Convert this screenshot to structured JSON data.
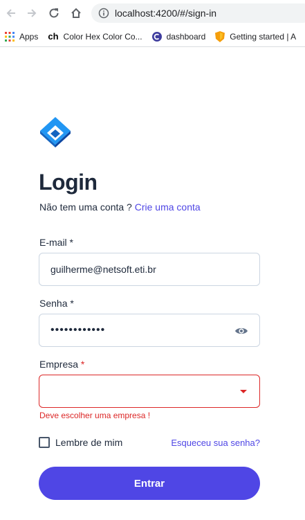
{
  "browser": {
    "url": "localhost:4200/#/sign-in",
    "bookmarks": [
      {
        "label": "Apps",
        "icon": "apps-grid-icon"
      },
      {
        "label": "Color Hex Color Co...",
        "icon": "colorhex-icon"
      },
      {
        "label": "dashboard",
        "icon": "dashboard-icon"
      },
      {
        "label": "Getting started | A",
        "icon": "shield-icon"
      }
    ]
  },
  "login": {
    "title": "Login",
    "no_account_text": "Não tem uma conta ?",
    "create_account_link": "Crie uma conta",
    "email": {
      "label": "E-mail *",
      "value": "guilherme@netsoft.eti.br"
    },
    "password": {
      "label": "Senha *",
      "value": "••••••••••••"
    },
    "company": {
      "label": "Empresa",
      "required_mark": "*",
      "value": "",
      "error": "Deve escolher uma empresa !"
    },
    "remember_me": {
      "label": "Lembre de mim",
      "checked": false
    },
    "forgot_password": "Esqueceu sua senha?",
    "submit": "Entrar"
  },
  "colors": {
    "primary": "#4f46e5",
    "error": "#dc2626",
    "text": "#1e293b",
    "logo_light": "#2196f3",
    "logo_dark": "#1565c0"
  }
}
